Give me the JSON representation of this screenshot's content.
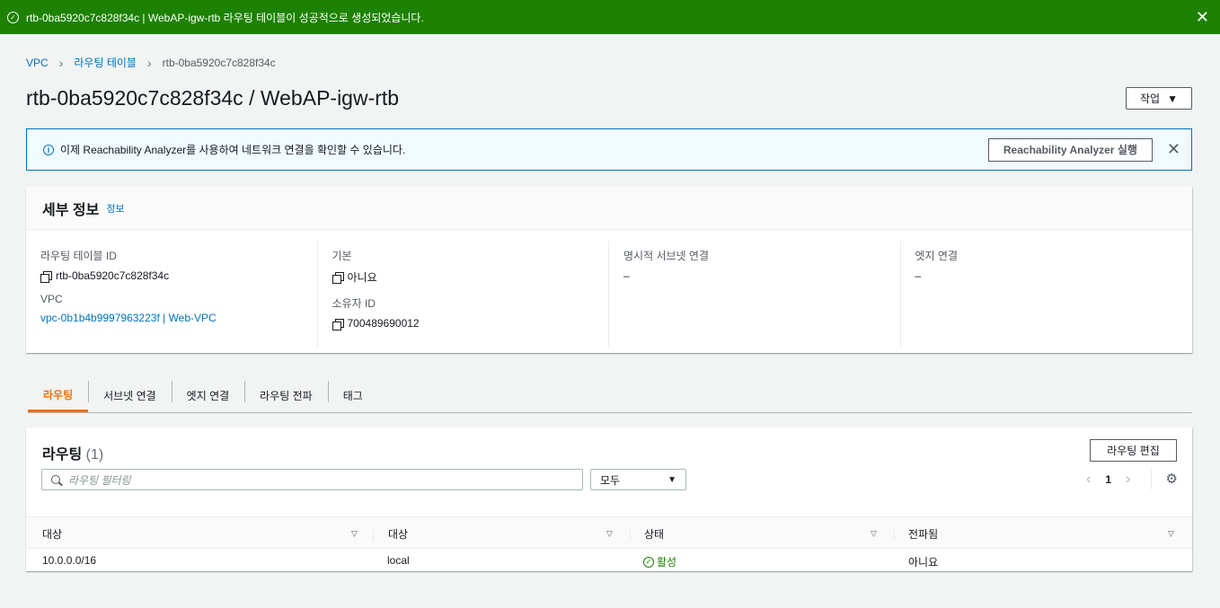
{
  "flash": {
    "message": "rtb-0ba5920c7c828f34c | WebAP-igw-rtb 라우팅 테이블이 성공적으로 생성되었습니다.",
    "icon": "check-circle-icon",
    "color": "#1d8102"
  },
  "breadcrumb": {
    "items": [
      "VPC",
      "라우팅 테이블",
      "rtb-0ba5920c7c828f34c"
    ]
  },
  "page": {
    "title": "rtb-0ba5920c7c828f34c / WebAP-igw-rtb",
    "actions_label": "작업"
  },
  "info_banner": {
    "text": "이제 Reachability Analyzer를 사용하여 네트워크 연결을 확인할 수 있습니다.",
    "button": "Reachability Analyzer 실행"
  },
  "details": {
    "title": "세부 정보",
    "info_link": "정보",
    "route_table_id_label": "라우팅 테이블 ID",
    "route_table_id": "rtb-0ba5920c7c828f34c",
    "vpc_label": "VPC",
    "vpc": "vpc-0b1b4b9997963223f | Web-VPC",
    "main_label": "기본",
    "main": "아니요",
    "owner_label": "소유자 ID",
    "owner": "700489690012",
    "explicit_subnet_label": "명시적 서브넷 연결",
    "explicit_subnet": "–",
    "edge_label": "엣지 연결",
    "edge": "–"
  },
  "tabs": [
    "라우팅",
    "서브넷 연결",
    "엣지 연결",
    "라우팅 전파",
    "태그"
  ],
  "routes": {
    "title": "라우팅",
    "count": "(1)",
    "edit_button": "라우팅 편집",
    "search_placeholder": "라우팅 필터링",
    "filter_value": "모두",
    "page": "1",
    "columns": [
      "대상",
      "대상",
      "상태",
      "전파됨"
    ],
    "rows": [
      {
        "destination": "10.0.0.0/16",
        "target": "local",
        "status": "활성",
        "propagated": "아니요"
      }
    ]
  },
  "colors": {
    "accent": "#ec7211",
    "link": "#0073bb",
    "success": "#1d8102"
  }
}
